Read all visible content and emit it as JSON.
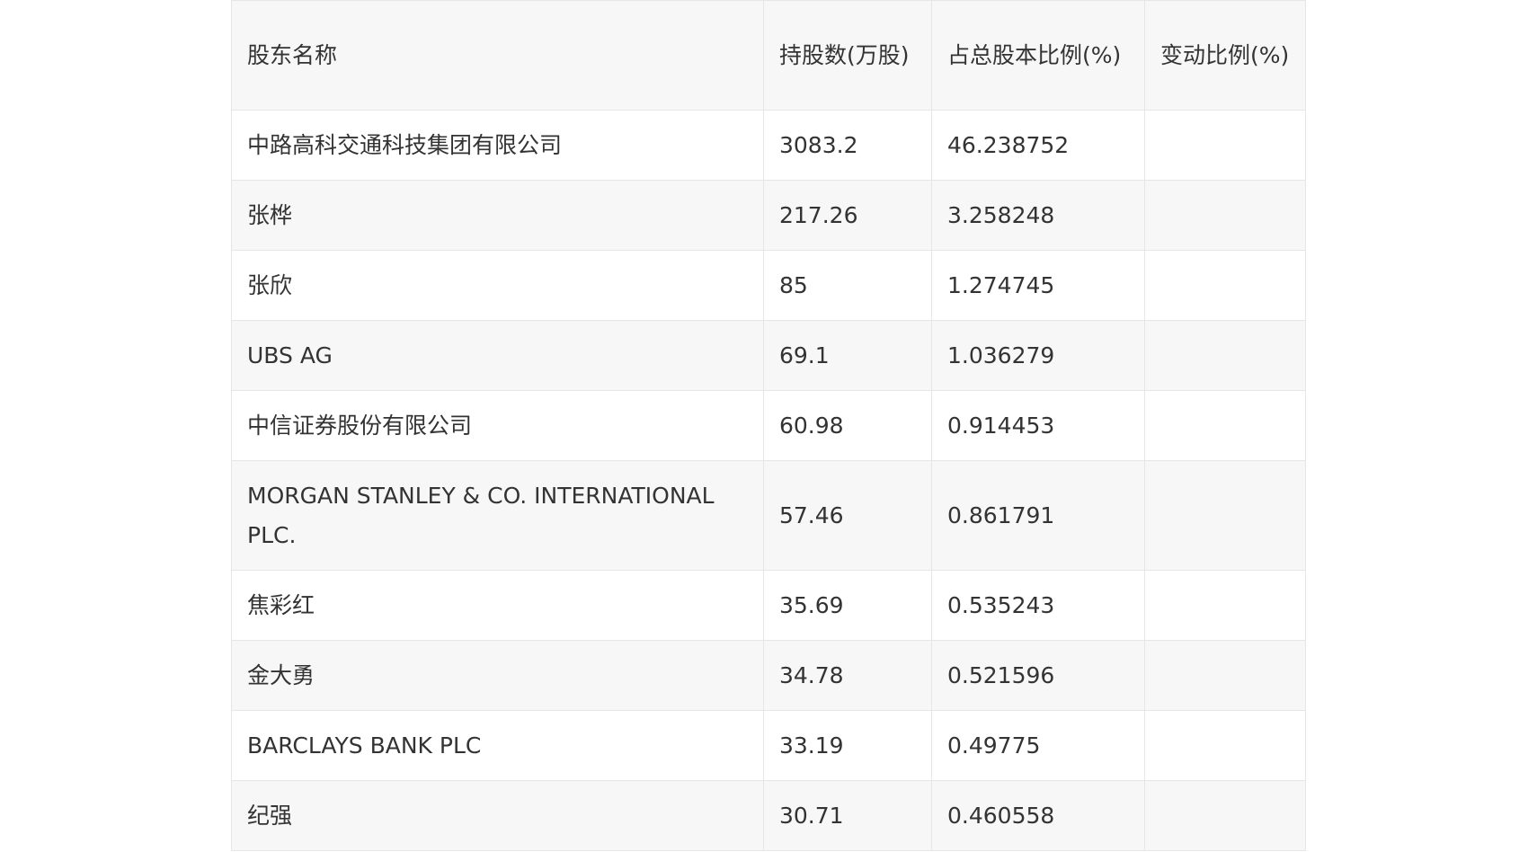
{
  "table": {
    "headers": [
      "股东名称",
      "持股数(万股)",
      "占总股本比例(%)",
      "变动比例(%)"
    ],
    "rows": [
      {
        "name": "中路高科交通科技集团有限公司",
        "shares": "3083.2",
        "ratio": "46.238752",
        "change": ""
      },
      {
        "name": "张桦",
        "shares": "217.26",
        "ratio": "3.258248",
        "change": ""
      },
      {
        "name": "张欣",
        "shares": "85",
        "ratio": "1.274745",
        "change": ""
      },
      {
        "name": "UBS AG",
        "shares": "69.1",
        "ratio": "1.036279",
        "change": ""
      },
      {
        "name": "中信证券股份有限公司",
        "shares": "60.98",
        "ratio": "0.914453",
        "change": ""
      },
      {
        "name": "MORGAN STANLEY & CO. INTERNATIONAL PLC.",
        "shares": "57.46",
        "ratio": "0.861791",
        "change": ""
      },
      {
        "name": "焦彩红",
        "shares": "35.69",
        "ratio": "0.535243",
        "change": ""
      },
      {
        "name": "金大勇",
        "shares": "34.78",
        "ratio": "0.521596",
        "change": ""
      },
      {
        "name": "BARCLAYS BANK PLC",
        "shares": "33.19",
        "ratio": "0.49775",
        "change": ""
      },
      {
        "name": "纪强",
        "shares": "30.71",
        "ratio": "0.460558",
        "change": ""
      }
    ]
  }
}
